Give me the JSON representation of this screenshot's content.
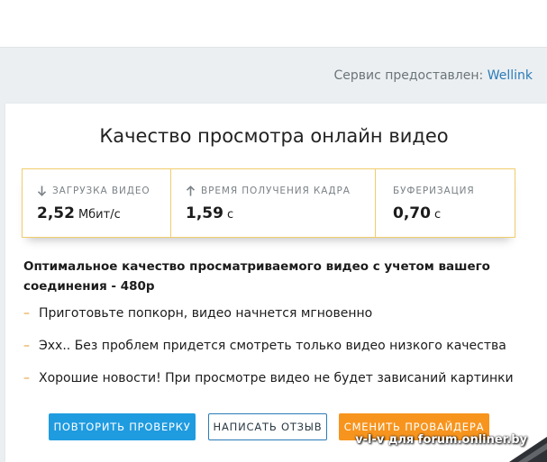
{
  "provider": {
    "label": "Сервис предоставлен:",
    "name": "Wellink"
  },
  "card": {
    "title": "Качество просмотра онлайн видео",
    "metrics": [
      {
        "label": "ЗАГРУЗКА ВИДЕО",
        "icon": "arrow-down-icon",
        "value": "2,52",
        "unit": "Мбит/с"
      },
      {
        "label": "ВРЕМЯ ПОЛУЧЕНИЯ КАДРА",
        "icon": "arrow-up-icon",
        "value": "1,59",
        "unit": "с"
      },
      {
        "label": "БУФЕРИЗАЦИЯ",
        "icon": "",
        "value": "0,70",
        "unit": "с"
      }
    ],
    "summary": "Оптимальное качество просматриваемого видео с учетом вашего соединения - 480p",
    "bullet_marker": "–",
    "tips": [
      "Приготовьте попкорн, видео начнется мгновенно",
      "Эхх.. Без проблем придется смотреть только видео низкого качества",
      "Хорошие новости! При просмотре видео не будет зависаний картинки"
    ],
    "buttons": {
      "retry": "ПОВТОРИТЬ ПРОВЕРКУ",
      "review": "НАПИСАТЬ ОТЗЫВ",
      "change_provider": "СМЕНИТЬ ПРОВАЙДЕРА"
    }
  },
  "watermark": "v-l-v для forum.onliner.by",
  "colors": {
    "accent_blue": "#1f9be0",
    "accent_orange": "#f7941d",
    "metrics_border": "#f0cd6b",
    "link": "#2a7bb8"
  }
}
